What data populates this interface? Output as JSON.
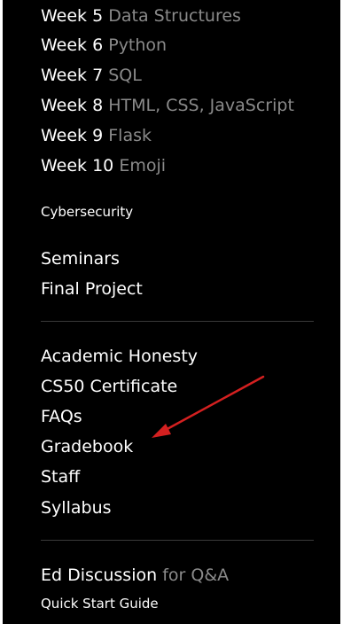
{
  "weeks": [
    {
      "num": "Week 5",
      "topic": "Data Structures"
    },
    {
      "num": "Week 6",
      "topic": "Python"
    },
    {
      "num": "Week 7",
      "topic": "SQL"
    },
    {
      "num": "Week 8",
      "topic": "HTML, CSS, JavaScript"
    },
    {
      "num": "Week 9",
      "topic": "Flask"
    },
    {
      "num": "Week 10",
      "topic": "Emoji"
    }
  ],
  "cybersecurity": "Cybersecurity",
  "extras": [
    "Seminars",
    "Final Project"
  ],
  "info": [
    "Academic Honesty",
    "CS50 Certificate",
    "FAQs",
    "Gradebook",
    "Staff",
    "Syllabus"
  ],
  "discussion": {
    "name": "Ed Discussion",
    "suffix": "for Q&A"
  },
  "quick_start": "Quick Start Guide",
  "colors": {
    "background": "#000000",
    "link": "#ffffff",
    "muted": "#8a8a8a",
    "annotation_arrow": "#d42020"
  }
}
